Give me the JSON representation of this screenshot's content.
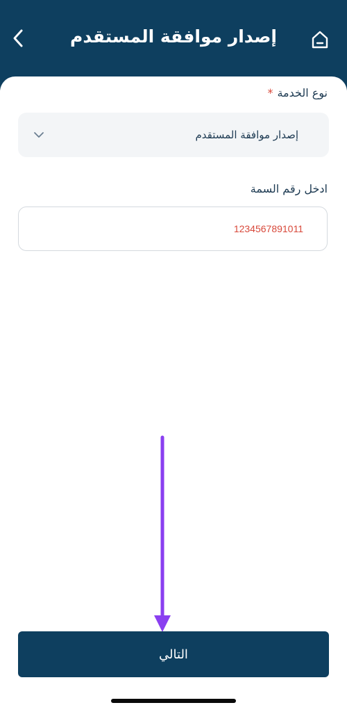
{
  "header": {
    "title": "إصدار موافقة المستقدم",
    "back_icon": "chevron-left-icon",
    "home_icon": "home-icon"
  },
  "form": {
    "service_type": {
      "label": "نوع الخدمة",
      "required_mark": "*",
      "selected_value": "إصدار موافقة المستقدم"
    },
    "visa_number": {
      "label": "ادخل رقم السمة",
      "value": "1234567891011"
    }
  },
  "footer": {
    "next_label": "التالي"
  },
  "colors": {
    "primary": "#0e3f5f",
    "required": "#d8483a",
    "input_value": "#d8483a",
    "annotation_arrow": "#8a3ff0"
  }
}
